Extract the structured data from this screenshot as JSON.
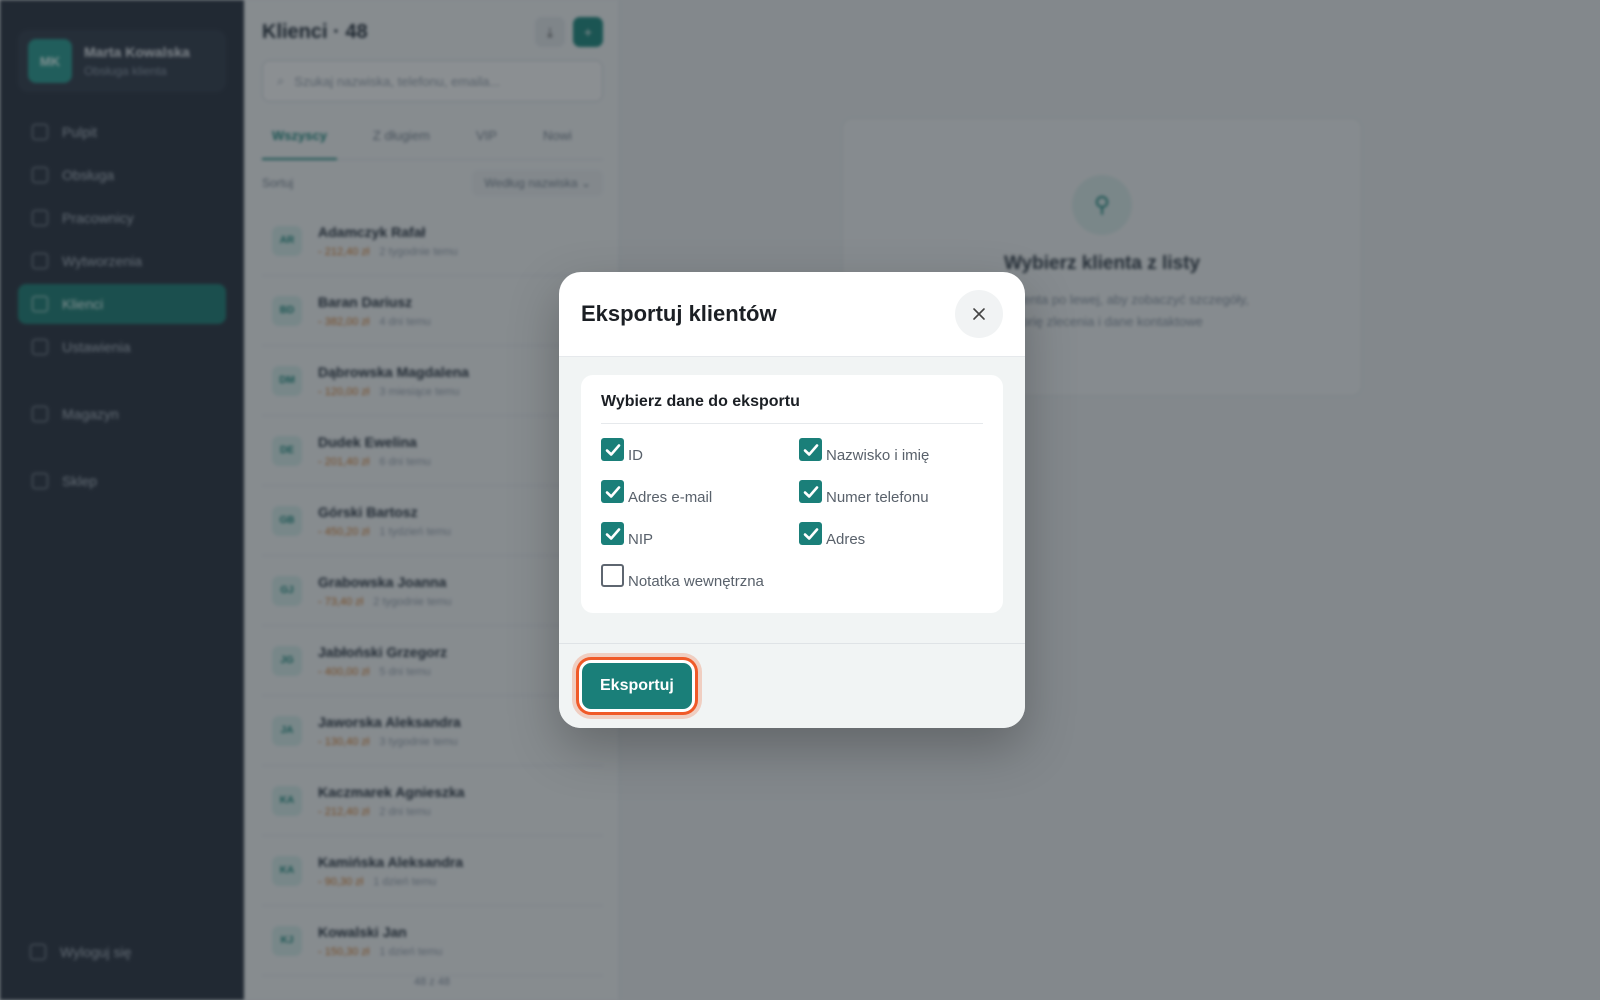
{
  "sidebar": {
    "user": {
      "initials": "MK",
      "name": "Marta Kowalska",
      "role": "Obsługa klienta"
    },
    "items": [
      {
        "label": "Pulpit",
        "icon": "home-icon"
      },
      {
        "label": "Obsługa",
        "icon": "clipboard-icon"
      },
      {
        "label": "Pracownicy",
        "icon": "person-icon"
      },
      {
        "label": "Wytworzenia",
        "icon": "wrench-icon"
      },
      {
        "label": "Klienci",
        "icon": "users-icon",
        "active": true
      },
      {
        "label": "Ustawienia",
        "icon": "gear-icon"
      },
      {
        "label": "Magazyn",
        "icon": "box-icon"
      },
      {
        "label": "Sklep",
        "icon": "phone-icon"
      }
    ],
    "logout_label": "Wyloguj się"
  },
  "list": {
    "title": "Klienci · 48",
    "search_placeholder": "Szukaj nazwiska, telefonu, emaila...",
    "tabs": [
      "Wszyscy",
      "Z długiem",
      "VIP",
      "Nowi"
    ],
    "sort_label": "Sortuj",
    "sort_value": "Według nazwiska",
    "clients": [
      {
        "initials": "AR",
        "name": "Adamczyk Rafał",
        "amount": "- 212,40 zł",
        "meta": "2 tygodnie temu"
      },
      {
        "initials": "BD",
        "name": "Baran Dariusz",
        "amount": "- 382,00 zł",
        "meta": "4 dni temu"
      },
      {
        "initials": "DM",
        "name": "Dąbrowska Magdalena",
        "amount": "- 120,00 zł",
        "meta": "3 miesiące temu"
      },
      {
        "initials": "DE",
        "name": "Dudek Ewelina",
        "amount": "- 201,40 zł",
        "meta": "6 dni temu"
      },
      {
        "initials": "GB",
        "name": "Górski Bartosz",
        "amount": "- 450,20 zł",
        "meta": "1 tydzień temu"
      },
      {
        "initials": "GJ",
        "name": "Grabowska Joanna",
        "amount": "- 73,40 zł",
        "meta": "2 tygodnie temu"
      },
      {
        "initials": "JG",
        "name": "Jabłoński Grzegorz",
        "amount": "- 400,00 zł",
        "meta": "5 dni temu"
      },
      {
        "initials": "JA",
        "name": "Jaworska Aleksandra",
        "amount": "- 130,40 zł",
        "meta": "3 tygodnie temu"
      },
      {
        "initials": "KA",
        "name": "Kaczmarek Agnieszka",
        "amount": "- 212,40 zł",
        "meta": "2 dni temu"
      },
      {
        "initials": "KA",
        "name": "Kamińska Aleksandra",
        "amount": "- 90,30 zł",
        "meta": "1 dzień temu"
      },
      {
        "initials": "KJ",
        "name": "Kowalski Jan",
        "amount": "- 150,30 zł",
        "meta": "1 dzień temu"
      }
    ],
    "footer": "48 z 48"
  },
  "detail": {
    "empty_title": "Wybierz klienta z listy",
    "empty_text_1": "Kliknij na klienta po lewej, aby zobaczyć szczegóły,",
    "empty_text_2": "historię zlecenia i dane kontaktowe"
  },
  "modal": {
    "title": "Eksportuj klientów",
    "section_title": "Wybierz dane do eksportu",
    "fields": [
      {
        "label": "ID",
        "checked": true
      },
      {
        "label": "Nazwisko i imię",
        "checked": true
      },
      {
        "label": "Adres e-mail",
        "checked": true
      },
      {
        "label": "Numer telefonu",
        "checked": true
      },
      {
        "label": "NIP",
        "checked": true
      },
      {
        "label": "Adres",
        "checked": true
      },
      {
        "label": "Notatka wewnętrzna",
        "checked": false
      }
    ],
    "export_label": "Eksportuj",
    "accent_color": "#1a7f79",
    "focus_ring_color": "#f05a28"
  }
}
